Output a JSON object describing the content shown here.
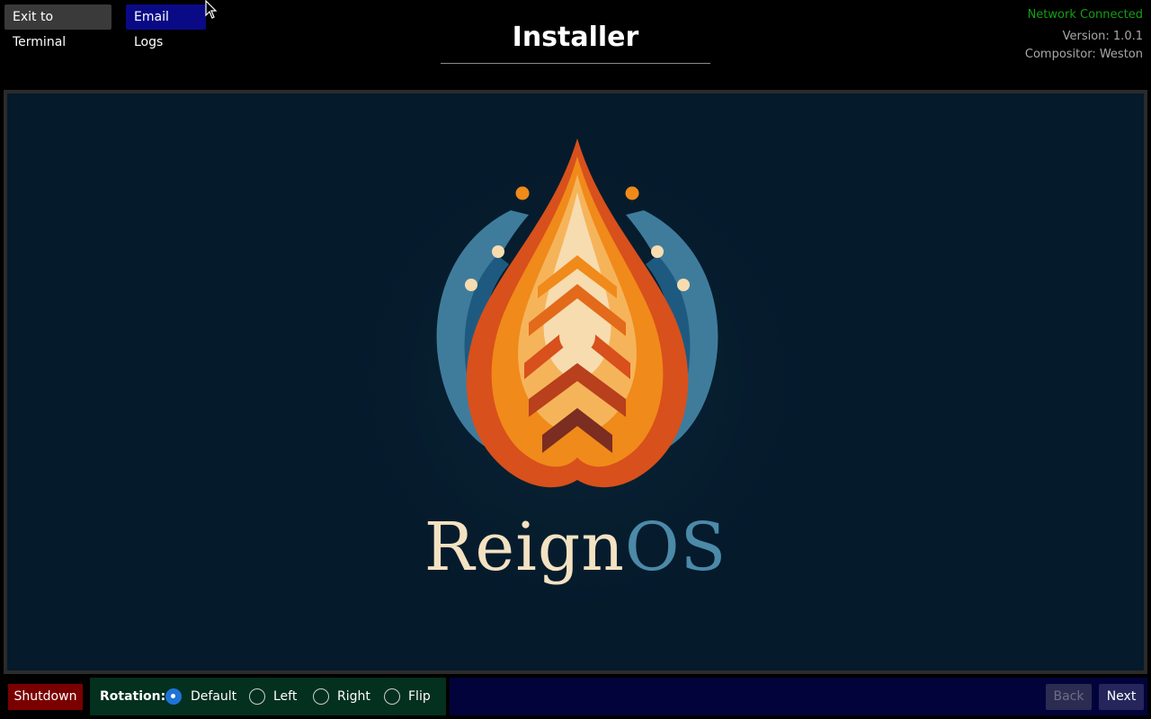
{
  "header": {
    "exit_label": "Exit to Terminal",
    "email_label": "Email Logs",
    "title": "Installer",
    "network_status": "Network Connected",
    "version": "Version: 1.0.1",
    "compositor": "Compositor: Weston"
  },
  "logo": {
    "brand_part1": "Reign",
    "brand_part2": "OS",
    "colors": {
      "background": "#051a2b",
      "cream": "#f3e2c2",
      "orange": "#f08a1a",
      "deep_orange": "#d8501c",
      "blue": "#4b8aa8"
    }
  },
  "footer": {
    "shutdown_label": "Shutdown",
    "rotation_label": "Rotation:",
    "rotation_options": [
      "Default",
      "Left",
      "Right",
      "Flip"
    ],
    "rotation_selected": "Default",
    "back_label": "Back",
    "next_label": "Next"
  },
  "colors": {
    "network_ok": "#12a012",
    "shutdown_bg": "#7a0000",
    "rotation_bg": "#03301f",
    "nav_bg": "#03033c",
    "radio_checked": "#1e73d8"
  }
}
